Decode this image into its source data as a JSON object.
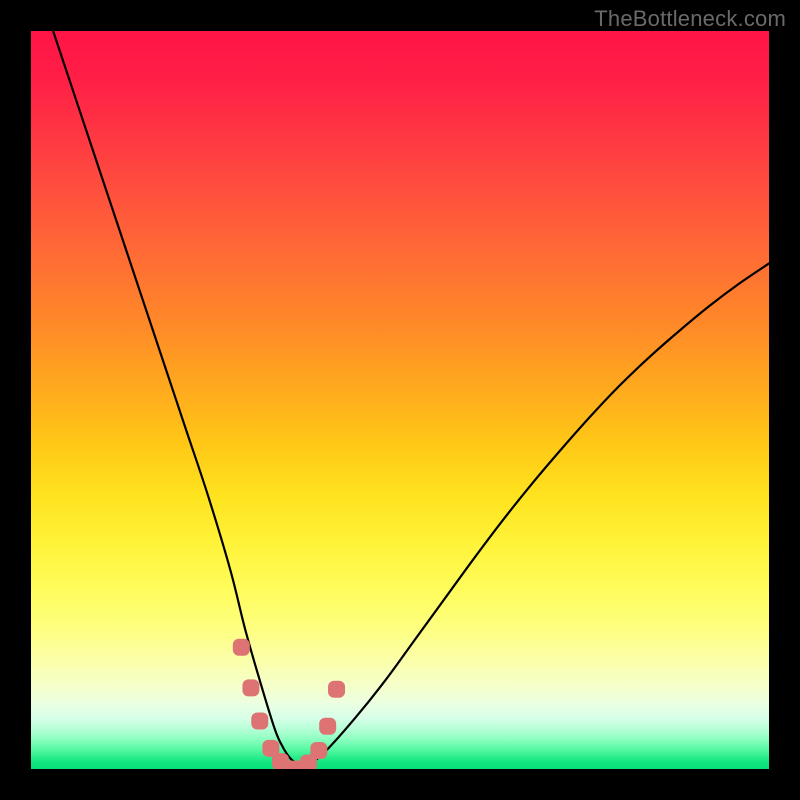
{
  "watermark": "TheBottleneck.com",
  "colors": {
    "frame": "#000000",
    "curve_stroke": "#000000",
    "marker_fill": "#dd7373",
    "gradient_top": "#ff1446",
    "gradient_mid": "#fff43c",
    "gradient_bottom": "#08e07a"
  },
  "chart_data": {
    "type": "line",
    "title": "",
    "xlabel": "",
    "ylabel": "",
    "xlim": [
      0,
      100
    ],
    "ylim": [
      0,
      100
    ],
    "note": "Axes are unlabeled; x is an implicit 0–100 horizontal index, y is 0 (bottom/green) to 100 (top/red). Two black curves descend into a V-shaped minimum near x≈33–37; red rounded markers sit along the trough. Background gradient encodes y from red (high) through yellow to green (low).",
    "series": [
      {
        "name": "left-curve",
        "x": [
          3,
          6,
          9,
          12,
          15,
          18,
          21,
          24,
          27,
          29,
          31,
          33,
          34,
          35,
          36,
          37
        ],
        "y": [
          100,
          91,
          82,
          73,
          64,
          55,
          46,
          37,
          27,
          19,
          12,
          5.5,
          3.2,
          1.6,
          0.7,
          0.0
        ]
      },
      {
        "name": "right-curve",
        "x": [
          37,
          40,
          44,
          48,
          52,
          56,
          60,
          64,
          68,
          72,
          76,
          80,
          84,
          88,
          92,
          96,
          100
        ],
        "y": [
          0.0,
          2.5,
          7.0,
          12.0,
          17.5,
          23.0,
          28.5,
          33.8,
          38.8,
          43.5,
          48.0,
          52.2,
          56.0,
          59.5,
          62.8,
          65.8,
          68.5
        ]
      }
    ],
    "markers": {
      "name": "trough-markers",
      "x": [
        28.5,
        29.8,
        31.0,
        32.5,
        33.8,
        35.0,
        36.2,
        37.6,
        39.0,
        40.2,
        41.4
      ],
      "y": [
        16.5,
        11.0,
        6.5,
        2.8,
        1.0,
        0.0,
        0.0,
        0.8,
        2.5,
        5.8,
        10.8
      ]
    }
  }
}
